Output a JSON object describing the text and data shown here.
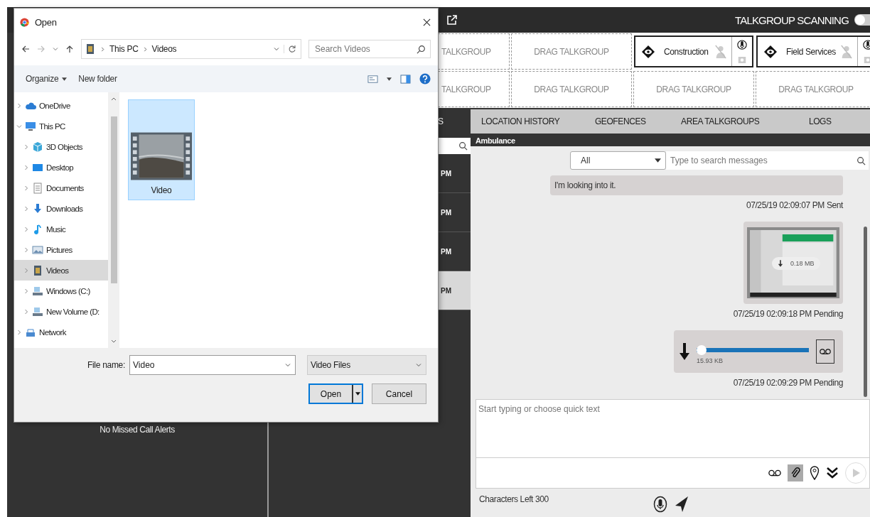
{
  "app": {
    "top_bar": {
      "title": "TALKGROUP SCANNING",
      "scanning_on": false
    },
    "talkgroup_grid": {
      "rows": [
        [
          {
            "kind": "empty",
            "label": "TALKGROUP"
          },
          {
            "kind": "empty",
            "label": "DRAG TALKGROUP"
          },
          {
            "kind": "group",
            "label": "Construction"
          },
          {
            "kind": "group",
            "label": "Field Services"
          }
        ],
        [
          {
            "kind": "empty",
            "label": "TALKGROUP"
          },
          {
            "kind": "empty",
            "label": "DRAG TALKGROUP"
          },
          {
            "kind": "empty",
            "label": "DRAG TALKGROUP"
          },
          {
            "kind": "empty",
            "label": "DRAG TALKGROUP"
          }
        ]
      ]
    },
    "tabs": [
      {
        "label": "S",
        "selected": true
      },
      {
        "label": "LOCATION HISTORY",
        "selected": false
      },
      {
        "label": "GEOFENCES",
        "selected": false
      },
      {
        "label": "AREA TALKGROUPS",
        "selected": false
      },
      {
        "label": "LOGS",
        "selected": false
      }
    ],
    "conversations": [
      {
        "time": "PM",
        "selected": false
      },
      {
        "time": "PM",
        "selected": false
      },
      {
        "time": "PM",
        "selected": false
      },
      {
        "time": "PM",
        "selected": true
      }
    ],
    "missed_calls": {
      "message": "No Missed Call Alerts"
    },
    "chat": {
      "title": "Ambulance",
      "filter": {
        "value": "All"
      },
      "search": {
        "placeholder": "Type to search messages"
      },
      "messages": [
        {
          "kind": "text",
          "text": "I'm looking into it.",
          "meta": "07/25/19 02:09:07 PM Sent"
        },
        {
          "kind": "image",
          "size": "0.18 MB",
          "meta": "07/25/19 02:09:18 PM Pending"
        },
        {
          "kind": "audio",
          "size": "15.93 KB",
          "level": 0,
          "meta": "07/25/19 02:09:29 PM Pending"
        }
      ],
      "compose": {
        "placeholder": "Start typing or choose quick text",
        "attach_active": true,
        "send_disabled": true
      },
      "characters_left": "Characters Left 300"
    }
  },
  "dialog": {
    "title": "Open",
    "path": [
      "This PC",
      "Videos"
    ],
    "search": {
      "placeholder": "Search Videos"
    },
    "toolbar": {
      "organize": "Organize",
      "new_folder": "New folder"
    },
    "nav": [
      {
        "label": "OneDrive",
        "kind": "cloud",
        "expanded": false,
        "selected": false
      },
      {
        "label": "This PC",
        "kind": "computer",
        "expanded": true,
        "selected": false,
        "children": [
          {
            "label": "3D Objects",
            "kind": "objects",
            "expanded": false,
            "selected": false
          },
          {
            "label": "Desktop",
            "kind": "desktop",
            "expanded": false,
            "selected": false
          },
          {
            "label": "Documents",
            "kind": "documents",
            "expanded": false,
            "selected": false
          },
          {
            "label": "Downloads",
            "kind": "downloads",
            "expanded": false,
            "selected": false
          },
          {
            "label": "Music",
            "kind": "music",
            "expanded": false,
            "selected": false
          },
          {
            "label": "Pictures",
            "kind": "pictures",
            "expanded": false,
            "selected": false
          },
          {
            "label": "Videos",
            "kind": "videos",
            "expanded": false,
            "selected": true
          },
          {
            "label": "Windows (C:)",
            "kind": "drive",
            "expanded": false,
            "selected": false
          },
          {
            "label": "New Volume (D:",
            "kind": "drive",
            "expanded": false,
            "selected": false
          }
        ]
      },
      {
        "label": "Network",
        "kind": "network",
        "expanded": false,
        "selected": false
      }
    ],
    "files": [
      {
        "name": "Video",
        "selected": true
      }
    ],
    "file_name": {
      "label": "File name:",
      "value": "Video"
    },
    "file_type": {
      "value": "Video Files"
    },
    "buttons": [
      {
        "label": "Open",
        "kind": "split"
      },
      {
        "label": "Cancel",
        "kind": "plain"
      }
    ]
  }
}
